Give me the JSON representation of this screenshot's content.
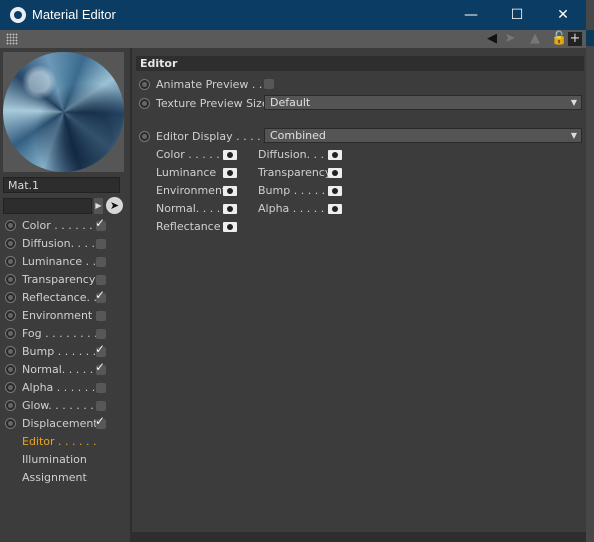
{
  "window": {
    "title": "Material Editor",
    "controls": {
      "minimize": "—",
      "maximize": "☐",
      "close": "✕"
    }
  },
  "toolbar": {
    "icons": [
      "grip-icon",
      "back-arrow-icon",
      "forward-arrow-icon",
      "up-arrow-icon",
      "lock-icon",
      "new-panel-icon"
    ]
  },
  "material": {
    "name": "Mat.1",
    "search_value": ""
  },
  "channels": [
    {
      "label": "Color . . . . . .",
      "checked": true
    },
    {
      "label": "Diffusion. . . .",
      "checked": false
    },
    {
      "label": "Luminance . .",
      "checked": false
    },
    {
      "label": "Transparency",
      "checked": false
    },
    {
      "label": "Reflectance. .",
      "checked": true
    },
    {
      "label": "Environment",
      "checked": false
    },
    {
      "label": "Fog . . . . . . . .",
      "checked": false
    },
    {
      "label": "Bump . . . . . .",
      "checked": true
    },
    {
      "label": "Normal. . . . .",
      "checked": true
    },
    {
      "label": "Alpha . . . . . .",
      "checked": false
    },
    {
      "label": "Glow. . . . . . .",
      "checked": false
    },
    {
      "label": "Displacement",
      "checked": true
    }
  ],
  "pages": [
    {
      "label": "Editor . . . . . .",
      "active": true
    },
    {
      "label": "Illumination",
      "active": false
    },
    {
      "label": "Assignment",
      "active": false
    }
  ],
  "editor": {
    "section_title": "Editor",
    "animate_preview_label": "Animate Preview . . .",
    "animate_preview_checked": false,
    "texture_preview_label": "Texture Preview Size",
    "texture_preview_value": "Default",
    "editor_display_label": "Editor Display . . . . .",
    "editor_display_value": "Combined",
    "display_channels_left": [
      "Color . . . . .",
      "Luminance",
      "Environment",
      "Normal. . . .",
      "Reflectance"
    ],
    "display_channels_right": [
      "Diffusion. . . .",
      "Transparency",
      "Bump . . . . . .",
      "Alpha . . . . . ."
    ]
  },
  "colors": {
    "titlebar": "#0b3c63",
    "panel": "#3c3c3c",
    "active_page": "#e8a420"
  }
}
